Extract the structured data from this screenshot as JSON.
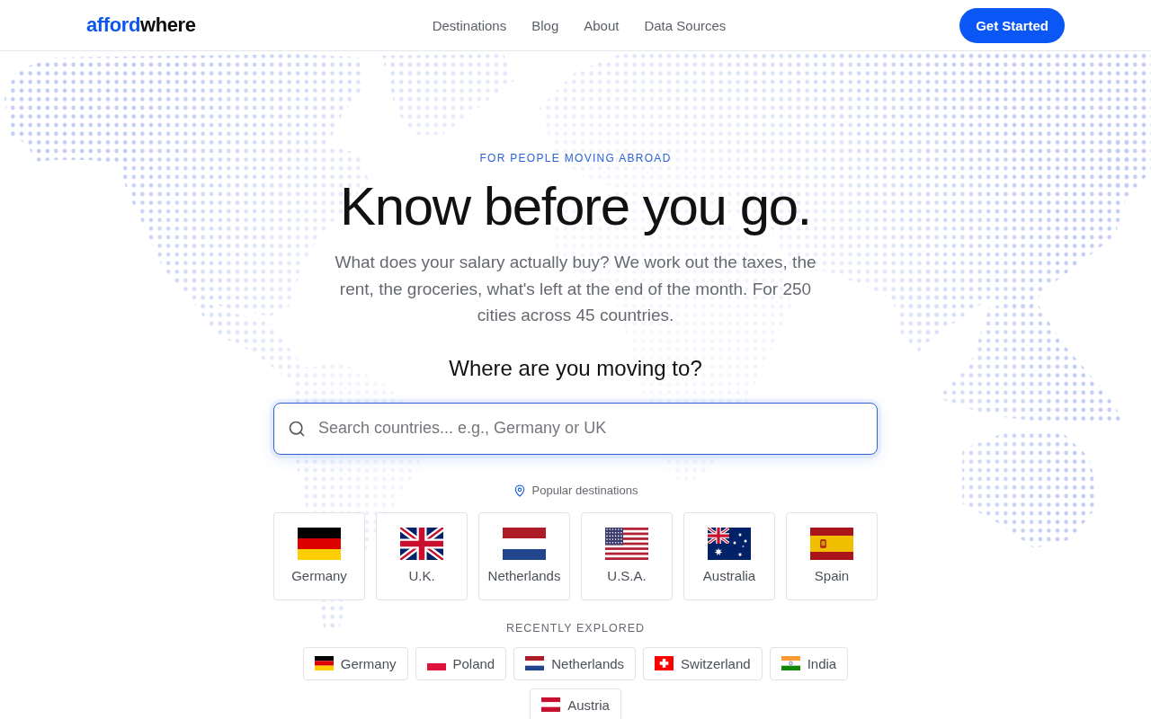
{
  "header": {
    "logo": [
      {
        "text": "afford",
        "kind": "accent"
      },
      {
        "text": "where",
        "kind": "plain"
      }
    ],
    "nav": [
      "Destinations",
      "Blog",
      "About",
      "Data Sources"
    ],
    "cta": "Get Started"
  },
  "hero": {
    "eyebrow": "FOR PEOPLE MOVING ABROAD",
    "title": "Know before you go.",
    "intro": "What does your salary actually buy? We work out the taxes, the rent, the groceries, what's left at the end of the month. For 250 cities across 45 countries.",
    "question": "Where are you moving to?"
  },
  "search": {
    "placeholder": "Search countries... e.g., Germany or UK"
  },
  "popular": {
    "label": "Popular destinations",
    "items": [
      {
        "name": "Germany",
        "kind": "de"
      },
      {
        "name": "U.K.",
        "kind": "gb"
      },
      {
        "name": "Netherlands",
        "kind": "nl"
      },
      {
        "name": "U.S.A.",
        "kind": "us"
      },
      {
        "name": "Australia",
        "kind": "au"
      },
      {
        "name": "Spain",
        "kind": "es"
      }
    ]
  },
  "recent": {
    "label": "RECENTLY EXPLORED",
    "items": [
      {
        "name": "Germany",
        "kind": "de"
      },
      {
        "name": "Poland",
        "kind": "pl"
      },
      {
        "name": "Netherlands",
        "kind": "nl"
      },
      {
        "name": "Switzerland",
        "kind": "ch"
      },
      {
        "name": "India",
        "kind": "in"
      },
      {
        "name": "Austria",
        "kind": "at"
      }
    ]
  }
}
